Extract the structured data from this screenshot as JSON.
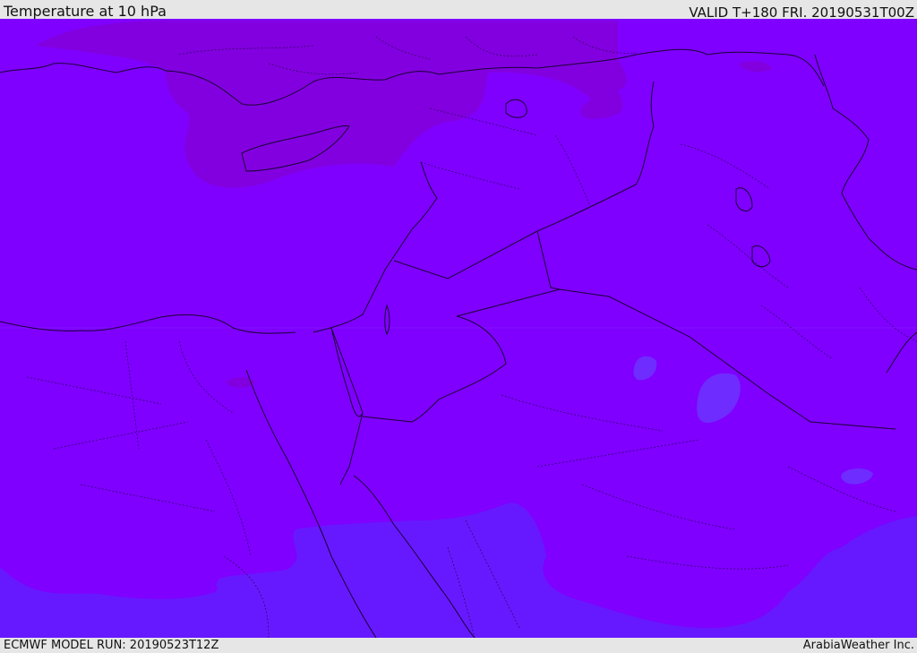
{
  "header": {
    "title": "Temperature at 10 hPa",
    "valid_time": "VALID T+180 FRI. 20190531T00Z"
  },
  "footer": {
    "model_run": "ECMWF MODEL RUN: 20190523T12Z",
    "credit": "ArabiaWeather Inc."
  },
  "colors": {
    "base_fill": "#7f00ff",
    "warm_fill": "#8200e0",
    "cool_fill": "#6619ff",
    "cool_patch": "#6f2cff",
    "coastline": "#1a0033",
    "border": "#1a0033"
  }
}
